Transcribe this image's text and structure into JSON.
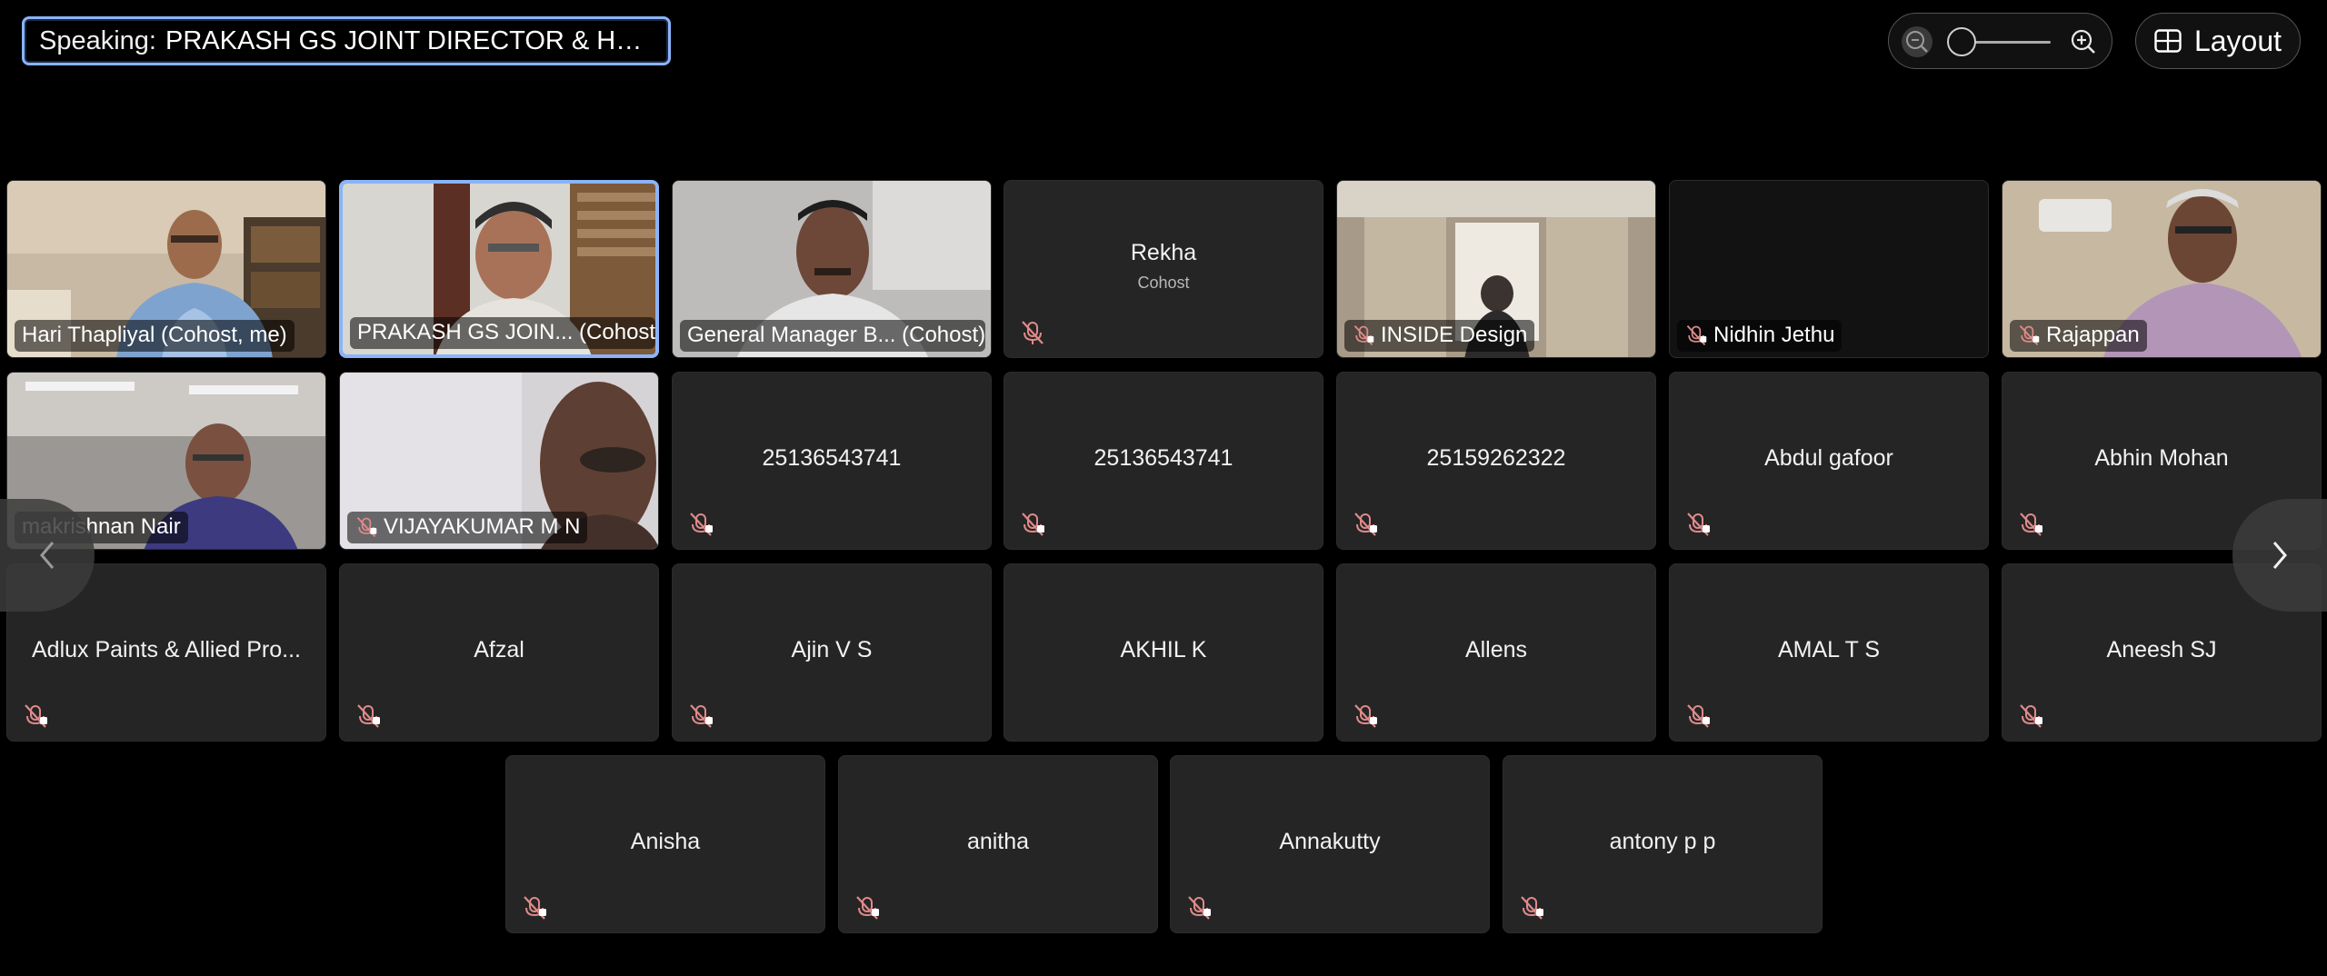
{
  "speaking": {
    "prefix": "Speaking:",
    "name": "PRAKASH GS JOINT DIRECTOR & HEAD O..."
  },
  "toolbar": {
    "layout_label": "Layout"
  },
  "colors": {
    "accent": "#8ab4f8",
    "tile_bg": "#252525",
    "muted_mic": "#e08a8a"
  },
  "video_tiles": [
    {
      "name": "Hari Thapliyal (Cohost, me)"
    },
    {
      "name": "PRAKASH GS JOIN... (Cohost)"
    },
    {
      "name": "General Manager B... (Cohost)"
    },
    {
      "name": "Rekha",
      "role": "Cohost"
    },
    {
      "name": "INSIDE Design"
    },
    {
      "name": "Nidhin Jethu"
    },
    {
      "name": "Rajappan"
    },
    {
      "name": "makrishnan Nair"
    },
    {
      "name": "VIJAYAKUMAR M N"
    }
  ],
  "name_tiles": [
    "25136543741",
    "25136543741",
    "25159262322",
    "Abdul gafoor",
    "Abhin Mohan",
    "Adlux Paints & Allied Pro...",
    "Afzal",
    "Ajin V S",
    "AKHIL K",
    "Allens",
    "AMAL T S",
    "Aneesh SJ",
    "Anisha",
    "anitha",
    "Annakutty",
    "antony p p"
  ]
}
